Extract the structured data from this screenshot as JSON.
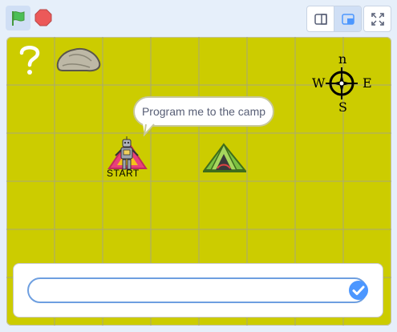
{
  "toolbar": {
    "green_flag_icon": "green-flag-icon",
    "stop_icon": "stop-sign-icon",
    "small_stage_icon": "small-stage-icon",
    "normal_stage_icon": "normal-stage-icon",
    "fullscreen_icon": "fullscreen-icon",
    "colors": {
      "flag": "#4cbf56",
      "stop": "#ec5959",
      "selected_bg": "#d0dff5"
    }
  },
  "stage": {
    "background_color": "#cccc00",
    "grid_color": "#a8a87a",
    "speech_bubble": "Program me to the camp",
    "start_label": "START",
    "sprites": [
      "question-mark",
      "rock",
      "robot",
      "warning-triangle",
      "tent",
      "compass"
    ],
    "compass": {
      "north": "n",
      "east": "E",
      "south": "S",
      "west": "W"
    }
  },
  "answer_box": {
    "value": "",
    "submit_icon": "checkmark-icon",
    "accent_color": "#4c97ff"
  }
}
